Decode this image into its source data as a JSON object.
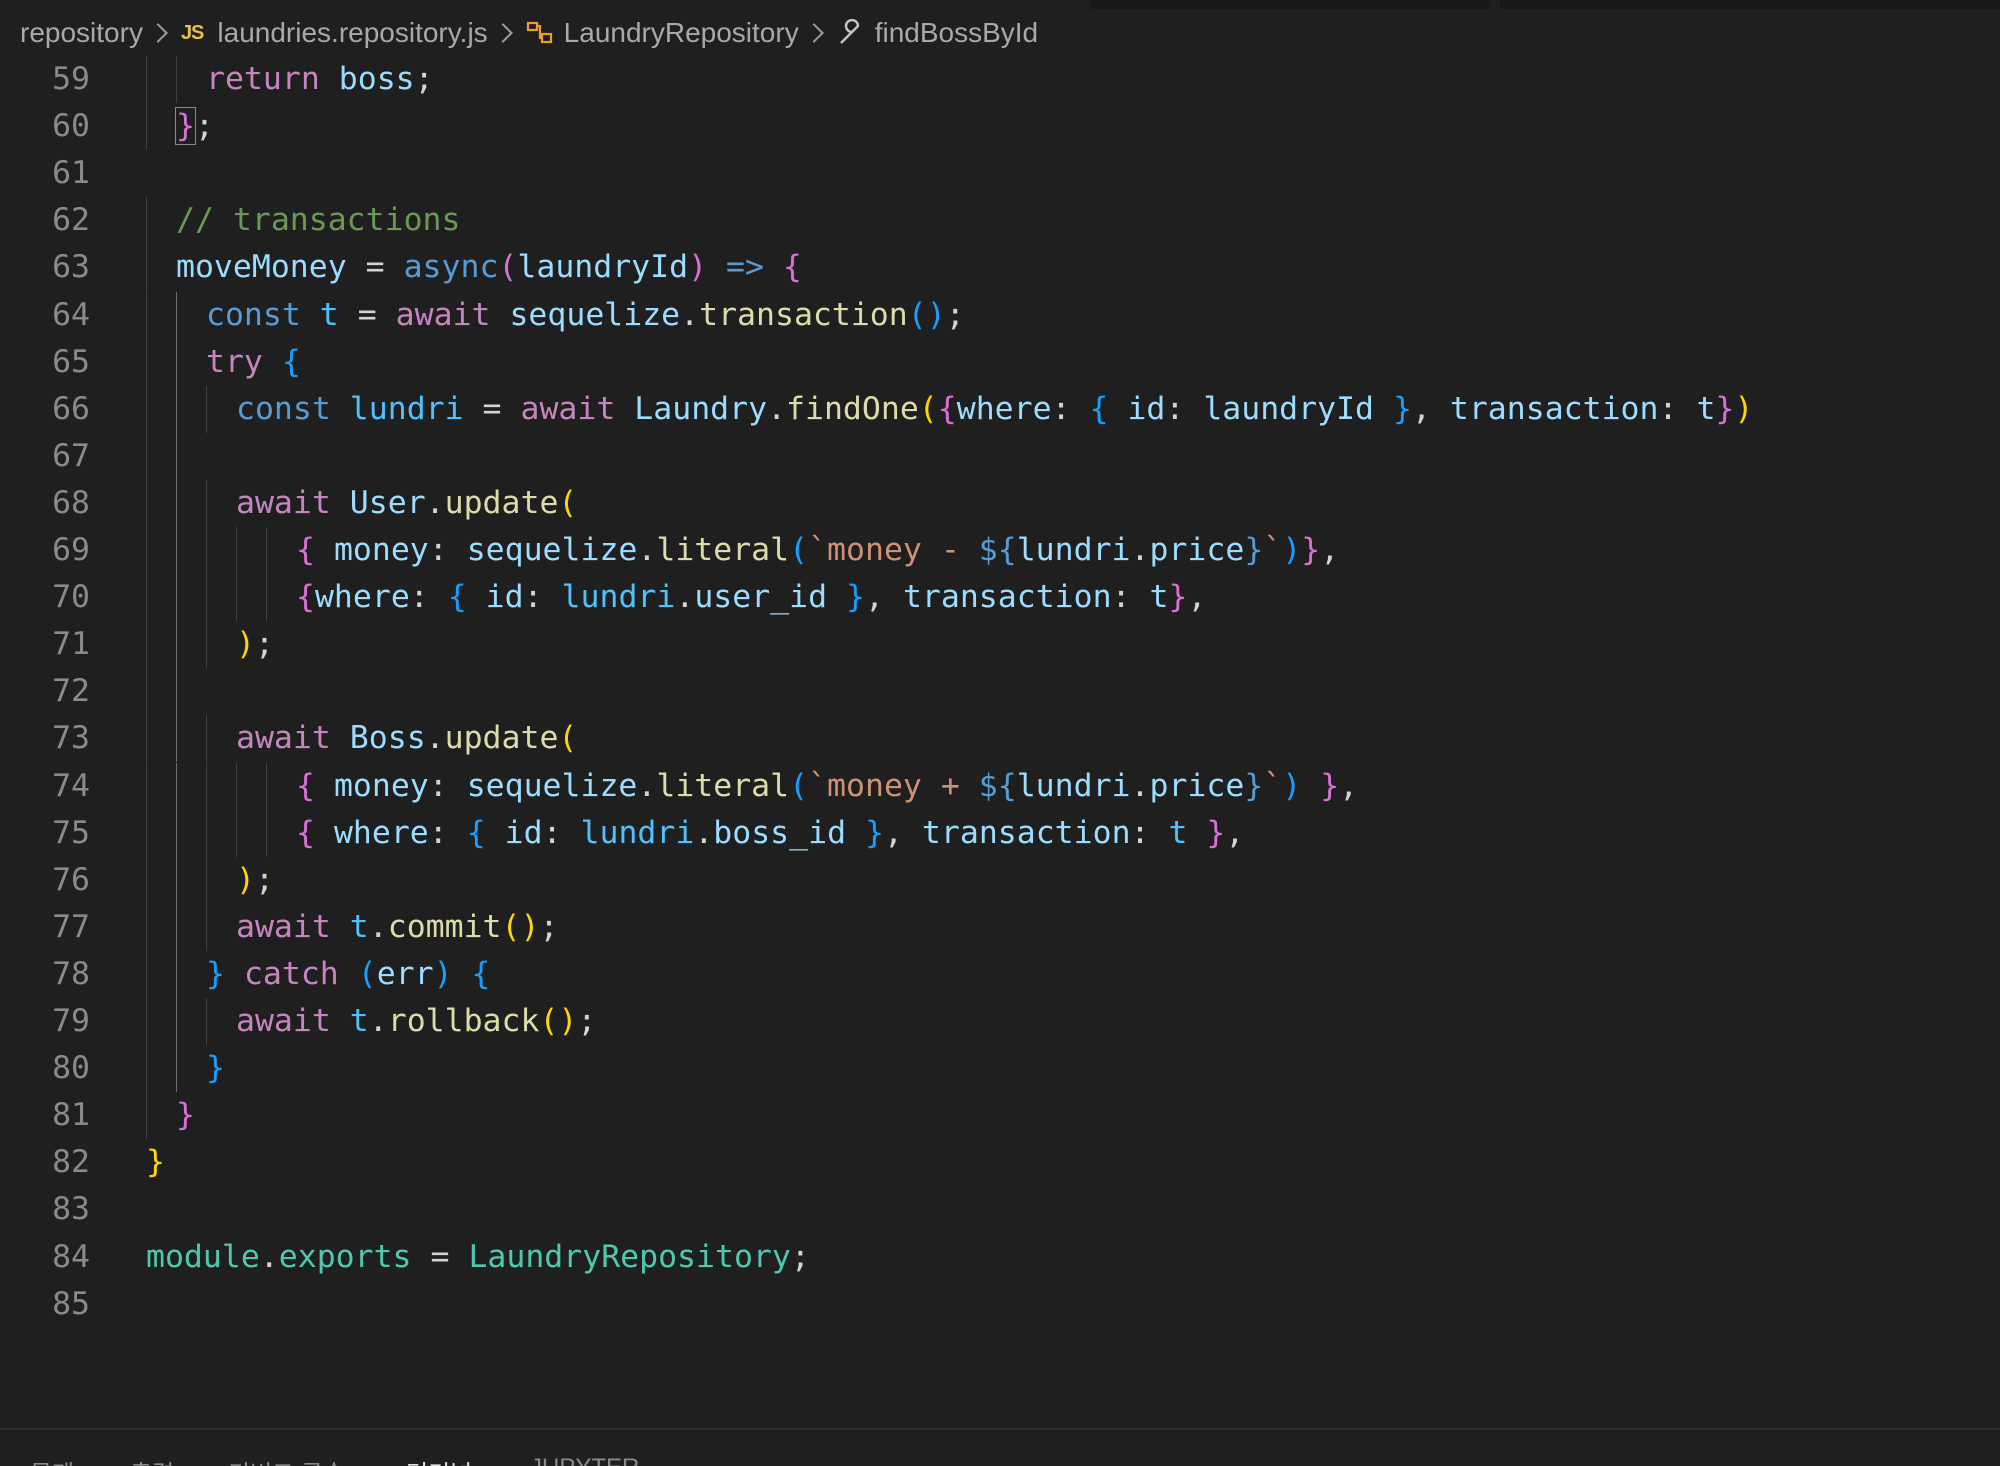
{
  "breadcrumb": {
    "items": [
      {
        "label": "repository",
        "icon": null
      },
      {
        "label": "laundries.repository.js",
        "icon": "javascript-file-icon",
        "badge": "JS"
      },
      {
        "label": "LaundryRepository",
        "icon": "class-symbol-icon"
      },
      {
        "label": "findBossById",
        "icon": "wrench-method-icon"
      }
    ]
  },
  "editor": {
    "language": "javascript",
    "lines": [
      {
        "n": "59",
        "indent": 2,
        "text": "return boss;",
        "tokens": [
          [
            "kw",
            "return"
          ],
          [
            "op",
            " "
          ],
          [
            "vr",
            "boss"
          ],
          [
            "op",
            ";"
          ]
        ]
      },
      {
        "n": "60",
        "indent": 1,
        "text": "};",
        "tokens": [
          [
            "b2",
            "}"
          ],
          [
            "op",
            ";"
          ]
        ]
      },
      {
        "n": "61",
        "indent": 0,
        "text": "",
        "tokens": []
      },
      {
        "n": "62",
        "indent": 1,
        "text": "// transactions",
        "tokens": [
          [
            "cm",
            "// transactions"
          ]
        ]
      },
      {
        "n": "63",
        "indent": 1,
        "text": "moveMoney = async(laundryId) => {",
        "tokens": [
          [
            "vr",
            "moveMoney"
          ],
          [
            "op",
            " = "
          ],
          [
            "st",
            "async"
          ],
          [
            "b2",
            "("
          ],
          [
            "vr",
            "laundryId"
          ],
          [
            "b2",
            ")"
          ],
          [
            "op",
            " "
          ],
          [
            "st",
            "=>"
          ],
          [
            "op",
            " "
          ],
          [
            "b2",
            "{"
          ]
        ]
      },
      {
        "n": "64",
        "indent": 2,
        "text": "const t = await sequelize.transaction();",
        "tokens": [
          [
            "st",
            "const"
          ],
          [
            "op",
            " "
          ],
          [
            "cn",
            "t"
          ],
          [
            "op",
            " = "
          ],
          [
            "kw",
            "await"
          ],
          [
            "op",
            " "
          ],
          [
            "vr",
            "sequelize"
          ],
          [
            "op",
            "."
          ],
          [
            "fn",
            "transaction"
          ],
          [
            "b3",
            "()"
          ],
          [
            "op",
            ";"
          ]
        ]
      },
      {
        "n": "65",
        "indent": 2,
        "text": "try {",
        "tokens": [
          [
            "kw",
            "try"
          ],
          [
            "op",
            " "
          ],
          [
            "b3",
            "{"
          ]
        ]
      },
      {
        "n": "66",
        "indent": 3,
        "text": "const lundri = await Laundry.findOne({where: { id: laundryId }, transaction: t})",
        "tokens": [
          [
            "st",
            "const"
          ],
          [
            "op",
            " "
          ],
          [
            "cn",
            "lundri"
          ],
          [
            "op",
            " = "
          ],
          [
            "kw",
            "await"
          ],
          [
            "op",
            " "
          ],
          [
            "vr",
            "Laundry"
          ],
          [
            "op",
            "."
          ],
          [
            "fn",
            "findOne"
          ],
          [
            "b1",
            "("
          ],
          [
            "b2",
            "{"
          ],
          [
            "vr",
            "where"
          ],
          [
            "op",
            ": "
          ],
          [
            "b3",
            "{"
          ],
          [
            "op",
            " "
          ],
          [
            "vr",
            "id"
          ],
          [
            "op",
            ": "
          ],
          [
            "vr",
            "laundryId"
          ],
          [
            "op",
            " "
          ],
          [
            "b3",
            "}"
          ],
          [
            "op",
            ", "
          ],
          [
            "vr",
            "transaction"
          ],
          [
            "op",
            ": "
          ],
          [
            "vr",
            "t"
          ],
          [
            "b2",
            "}"
          ],
          [
            "b1",
            ")"
          ]
        ]
      },
      {
        "n": "67",
        "indent": 3,
        "text": "",
        "tokens": []
      },
      {
        "n": "68",
        "indent": 3,
        "text": "await User.update(",
        "tokens": [
          [
            "kw",
            "await"
          ],
          [
            "op",
            " "
          ],
          [
            "vr",
            "User"
          ],
          [
            "op",
            "."
          ],
          [
            "fn",
            "update"
          ],
          [
            "b1",
            "("
          ]
        ]
      },
      {
        "n": "69",
        "indent": 5,
        "text": "{ money: sequelize.literal(`money - ${lundri.price}`)},",
        "tokens": [
          [
            "b2",
            "{"
          ],
          [
            "op",
            " "
          ],
          [
            "vr",
            "money"
          ],
          [
            "op",
            ": "
          ],
          [
            "vr",
            "sequelize"
          ],
          [
            "op",
            "."
          ],
          [
            "fn",
            "literal"
          ],
          [
            "b3",
            "("
          ],
          [
            "str",
            "`money - "
          ],
          [
            "st",
            "${"
          ],
          [
            "vr",
            "lundri"
          ],
          [
            "op",
            "."
          ],
          [
            "vr",
            "price"
          ],
          [
            "st",
            "}"
          ],
          [
            "str",
            "`"
          ],
          [
            "b3",
            ")"
          ],
          [
            "b2",
            "}"
          ],
          [
            "op",
            ","
          ]
        ]
      },
      {
        "n": "70",
        "indent": 5,
        "text": "{where: { id: lundri.user_id }, transaction: t},",
        "tokens": [
          [
            "b2",
            "{"
          ],
          [
            "vr",
            "where"
          ],
          [
            "op",
            ": "
          ],
          [
            "b3",
            "{"
          ],
          [
            "op",
            " "
          ],
          [
            "vr",
            "id"
          ],
          [
            "op",
            ": "
          ],
          [
            "cn",
            "lundri"
          ],
          [
            "op",
            "."
          ],
          [
            "vr",
            "user_id"
          ],
          [
            "op",
            " "
          ],
          [
            "b3",
            "}"
          ],
          [
            "op",
            ", "
          ],
          [
            "vr",
            "transaction"
          ],
          [
            "op",
            ": "
          ],
          [
            "vr",
            "t"
          ],
          [
            "b2",
            "}"
          ],
          [
            "op",
            ","
          ]
        ]
      },
      {
        "n": "71",
        "indent": 3,
        "text": ");",
        "tokens": [
          [
            "b1",
            ")"
          ],
          [
            "op",
            ";"
          ]
        ]
      },
      {
        "n": "72",
        "indent": 3,
        "text": "",
        "tokens": []
      },
      {
        "n": "73",
        "indent": 3,
        "text": "await Boss.update(",
        "tokens": [
          [
            "kw",
            "await"
          ],
          [
            "op",
            " "
          ],
          [
            "vr",
            "Boss"
          ],
          [
            "op",
            "."
          ],
          [
            "fn",
            "update"
          ],
          [
            "b1",
            "("
          ]
        ]
      },
      {
        "n": "74",
        "indent": 5,
        "text": "{ money: sequelize.literal(`money + ${lundri.price}`) },",
        "tokens": [
          [
            "b2",
            "{"
          ],
          [
            "op",
            " "
          ],
          [
            "vr",
            "money"
          ],
          [
            "op",
            ": "
          ],
          [
            "vr",
            "sequelize"
          ],
          [
            "op",
            "."
          ],
          [
            "fn",
            "literal"
          ],
          [
            "b3",
            "("
          ],
          [
            "str",
            "`money + "
          ],
          [
            "st",
            "${"
          ],
          [
            "vr",
            "lundri"
          ],
          [
            "op",
            "."
          ],
          [
            "vr",
            "price"
          ],
          [
            "st",
            "}"
          ],
          [
            "str",
            "`"
          ],
          [
            "b3",
            ")"
          ],
          [
            "op",
            " "
          ],
          [
            "b2",
            "}"
          ],
          [
            "op",
            ","
          ]
        ]
      },
      {
        "n": "75",
        "indent": 5,
        "text": "{ where: { id: lundri.boss_id }, transaction: t },",
        "tokens": [
          [
            "b2",
            "{"
          ],
          [
            "op",
            " "
          ],
          [
            "vr",
            "where"
          ],
          [
            "op",
            ": "
          ],
          [
            "b3",
            "{"
          ],
          [
            "op",
            " "
          ],
          [
            "vr",
            "id"
          ],
          [
            "op",
            ": "
          ],
          [
            "cn",
            "lundri"
          ],
          [
            "op",
            "."
          ],
          [
            "vr",
            "boss_id"
          ],
          [
            "op",
            " "
          ],
          [
            "b3",
            "}"
          ],
          [
            "op",
            ", "
          ],
          [
            "vr",
            "transaction"
          ],
          [
            "op",
            ": "
          ],
          [
            "cn",
            "t"
          ],
          [
            "op",
            " "
          ],
          [
            "b2",
            "}"
          ],
          [
            "op",
            ","
          ]
        ]
      },
      {
        "n": "76",
        "indent": 3,
        "text": ");",
        "tokens": [
          [
            "b1",
            ")"
          ],
          [
            "op",
            ";"
          ]
        ]
      },
      {
        "n": "77",
        "indent": 3,
        "text": "await t.commit();",
        "tokens": [
          [
            "kw",
            "await"
          ],
          [
            "op",
            " "
          ],
          [
            "cn",
            "t"
          ],
          [
            "op",
            "."
          ],
          [
            "fn",
            "commit"
          ],
          [
            "b1",
            "()"
          ],
          [
            "op",
            ";"
          ]
        ]
      },
      {
        "n": "78",
        "indent": 2,
        "text": "} catch (err) {",
        "tokens": [
          [
            "b3",
            "}"
          ],
          [
            "op",
            " "
          ],
          [
            "kw",
            "catch"
          ],
          [
            "op",
            " "
          ],
          [
            "b3",
            "("
          ],
          [
            "vr",
            "err"
          ],
          [
            "b3",
            ")"
          ],
          [
            "op",
            " "
          ],
          [
            "b3",
            "{"
          ]
        ]
      },
      {
        "n": "79",
        "indent": 3,
        "text": "await t.rollback();",
        "tokens": [
          [
            "kw",
            "await"
          ],
          [
            "op",
            " "
          ],
          [
            "cn",
            "t"
          ],
          [
            "op",
            "."
          ],
          [
            "fn",
            "rollback"
          ],
          [
            "b1",
            "()"
          ],
          [
            "op",
            ";"
          ]
        ]
      },
      {
        "n": "80",
        "indent": 2,
        "text": "}",
        "tokens": [
          [
            "b3",
            "}"
          ]
        ]
      },
      {
        "n": "81",
        "indent": 1,
        "text": "}",
        "tokens": [
          [
            "b2",
            "}"
          ]
        ]
      },
      {
        "n": "82",
        "indent": 0,
        "text": "}",
        "tokens": [
          [
            "b1",
            "}"
          ]
        ]
      },
      {
        "n": "83",
        "indent": 0,
        "text": "",
        "tokens": []
      },
      {
        "n": "84",
        "indent": 0,
        "text": "module.exports = LaundryRepository;",
        "tokens": [
          [
            "cl",
            "module"
          ],
          [
            "op",
            "."
          ],
          [
            "cl",
            "exports"
          ],
          [
            "op",
            " = "
          ],
          [
            "cl",
            "LaundryRepository"
          ],
          [
            "op",
            ";"
          ]
        ]
      },
      {
        "n": "85",
        "indent": 0,
        "text": "",
        "tokens": []
      }
    ]
  },
  "panel": {
    "tabs": [
      {
        "label": "문제",
        "active": false
      },
      {
        "label": "출력",
        "active": false
      },
      {
        "label": "디버그 콘솔",
        "active": false
      },
      {
        "label": "터미널",
        "active": true
      },
      {
        "label": "JUPYTER",
        "active": false
      }
    ]
  },
  "theme": {
    "background": "#1f1f1f",
    "keyword": "#c586c0",
    "storage": "#569cd6",
    "function": "#dcdcaa",
    "variable": "#9cdcfe",
    "constant": "#4fc1ff",
    "class": "#4ec9b0",
    "comment": "#6a9955",
    "string": "#ce9178",
    "bracket_1": "#ffd700",
    "bracket_2": "#da70d6",
    "bracket_3": "#179fff"
  }
}
